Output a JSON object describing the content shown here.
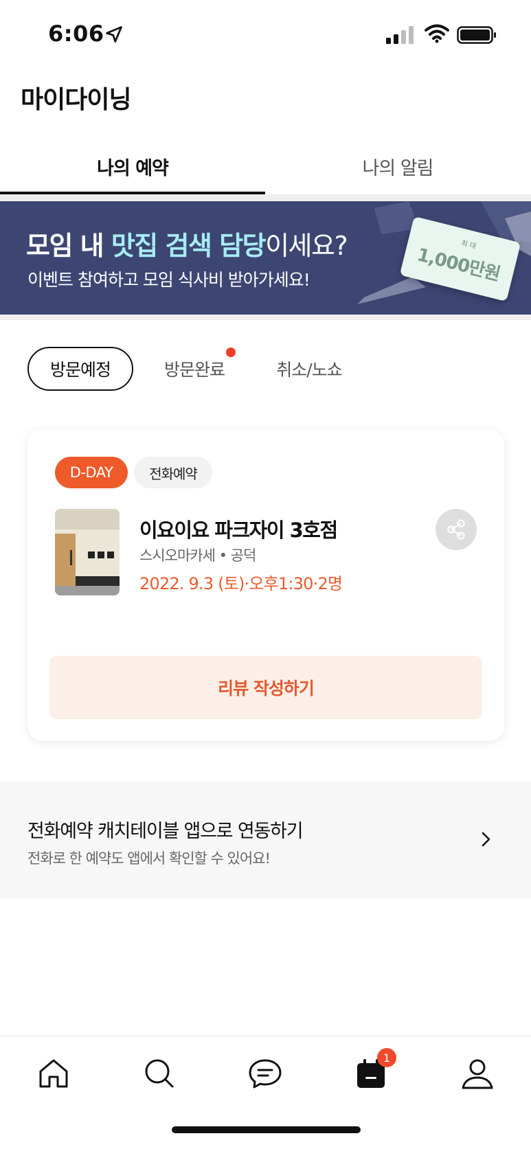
{
  "status_bar": {
    "time": "6:06"
  },
  "page_title": "마이다이닝",
  "top_tabs": [
    {
      "label": "나의 예약",
      "active": true
    },
    {
      "label": "나의 알림",
      "active": false
    }
  ],
  "banner": {
    "title_part1": "모임 내 ",
    "title_highlight": "맛집 검색 담당",
    "title_part2": "이세요?",
    "subtitle": "이벤트 참여하고 모임 식사비 받아가세요!",
    "card_max": "최 대",
    "card_amount": "1,000만원",
    "bg_color": "#3d4673",
    "highlight_color": "#a7ecf5"
  },
  "filter_chips": [
    {
      "label": "방문예정",
      "selected": true
    },
    {
      "label": "방문완료",
      "selected": false,
      "has_dot": true
    },
    {
      "label": "취소/노쇼",
      "selected": false
    }
  ],
  "reservation": {
    "badge_dday": "D-DAY",
    "badge_type": "전화예약",
    "restaurant_name": "이요이요 파크자이 3호점",
    "category": "스시오마카세 • 공덕",
    "datetime": "2022. 9.3 (토)·오후1:30·2명",
    "review_button": "리뷰 작성하기",
    "accent_color": "#ee5a2a"
  },
  "link_section": {
    "title": "전화예약 캐치테이블 앱으로 연동하기",
    "subtitle": "전화로 한 예약도 앱에서 확인할 수 있어요!"
  },
  "bottom_nav": {
    "items": [
      {
        "icon": "home-icon"
      },
      {
        "icon": "search-icon"
      },
      {
        "icon": "chat-icon"
      },
      {
        "icon": "calendar-icon"
      },
      {
        "icon": "profile-icon"
      }
    ],
    "reservation_badge": "1"
  }
}
